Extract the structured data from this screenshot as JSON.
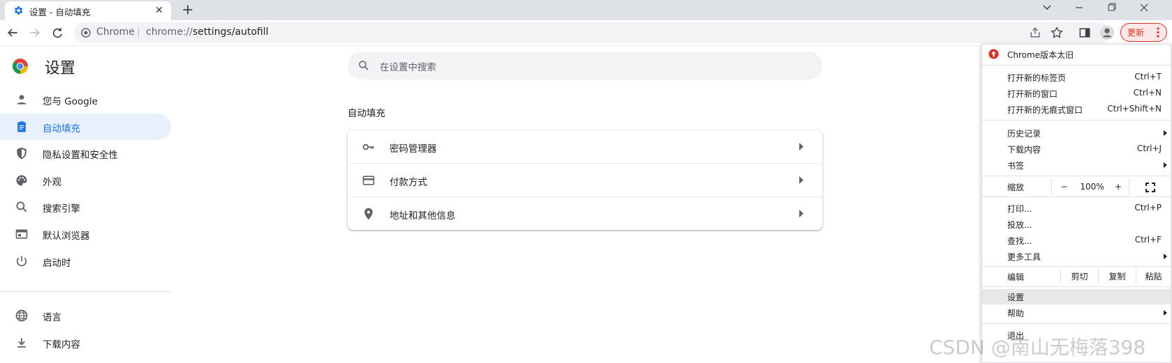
{
  "tab": {
    "title": "设置 - 自动填充",
    "icon": "gear-icon"
  },
  "omnibox": {
    "site_chip": "Chrome",
    "url_scheme": "chrome://",
    "url_path": "settings/autofill"
  },
  "toolbar": {
    "update_label": "更新"
  },
  "settings": {
    "title": "设置",
    "sidebar": [
      {
        "label": "您与 Google",
        "icon": "person-icon"
      },
      {
        "label": "自动填充",
        "icon": "clipboard-icon",
        "active": true
      },
      {
        "label": "隐私设置和安全性",
        "icon": "shield-icon"
      },
      {
        "label": "外观",
        "icon": "palette-icon"
      },
      {
        "label": "搜索引擎",
        "icon": "search-icon"
      },
      {
        "label": "默认浏览器",
        "icon": "browser-icon"
      },
      {
        "label": "启动时",
        "icon": "power-icon"
      },
      {
        "label": "语言",
        "icon": "globe-icon"
      },
      {
        "label": "下载内容",
        "icon": "download-icon"
      }
    ],
    "search_placeholder": "在设置中搜索",
    "section_title": "自动填充",
    "rows": [
      {
        "label": "密码管理器",
        "icon": "key-icon"
      },
      {
        "label": "付款方式",
        "icon": "credit-card-icon"
      },
      {
        "label": "地址和其他信息",
        "icon": "location-pin-icon"
      }
    ]
  },
  "menu": {
    "update_item": "Chrome版本太旧",
    "items_1": [
      {
        "label": "打开新的标签页",
        "shortcut": "Ctrl+T"
      },
      {
        "label": "打开新的窗口",
        "shortcut": "Ctrl+N"
      },
      {
        "label": "打开新的无痕式窗口",
        "shortcut": "Ctrl+Shift+N"
      }
    ],
    "items_2": [
      {
        "label": "历史记录",
        "shortcut": "",
        "submenu": true
      },
      {
        "label": "下载内容",
        "shortcut": "Ctrl+J"
      },
      {
        "label": "书签",
        "shortcut": "",
        "submenu": true
      }
    ],
    "zoom": {
      "label": "缩放",
      "minus": "−",
      "value": "100%",
      "plus": "+"
    },
    "items_3": [
      {
        "label": "打印...",
        "shortcut": "Ctrl+P"
      },
      {
        "label": "投放...",
        "shortcut": ""
      },
      {
        "label": "查找...",
        "shortcut": "Ctrl+F"
      },
      {
        "label": "更多工具",
        "shortcut": "",
        "submenu": true
      }
    ],
    "edit": {
      "label": "编辑",
      "cut": "剪切",
      "copy": "复制",
      "paste": "粘贴"
    },
    "settings": "设置",
    "help": "帮助",
    "exit": "退出"
  },
  "watermark": "CSDN @南山无梅落398",
  "colors": {
    "accent": "#1a73e8",
    "active_bg": "#e8f0fe",
    "update_red": "#d93025"
  }
}
